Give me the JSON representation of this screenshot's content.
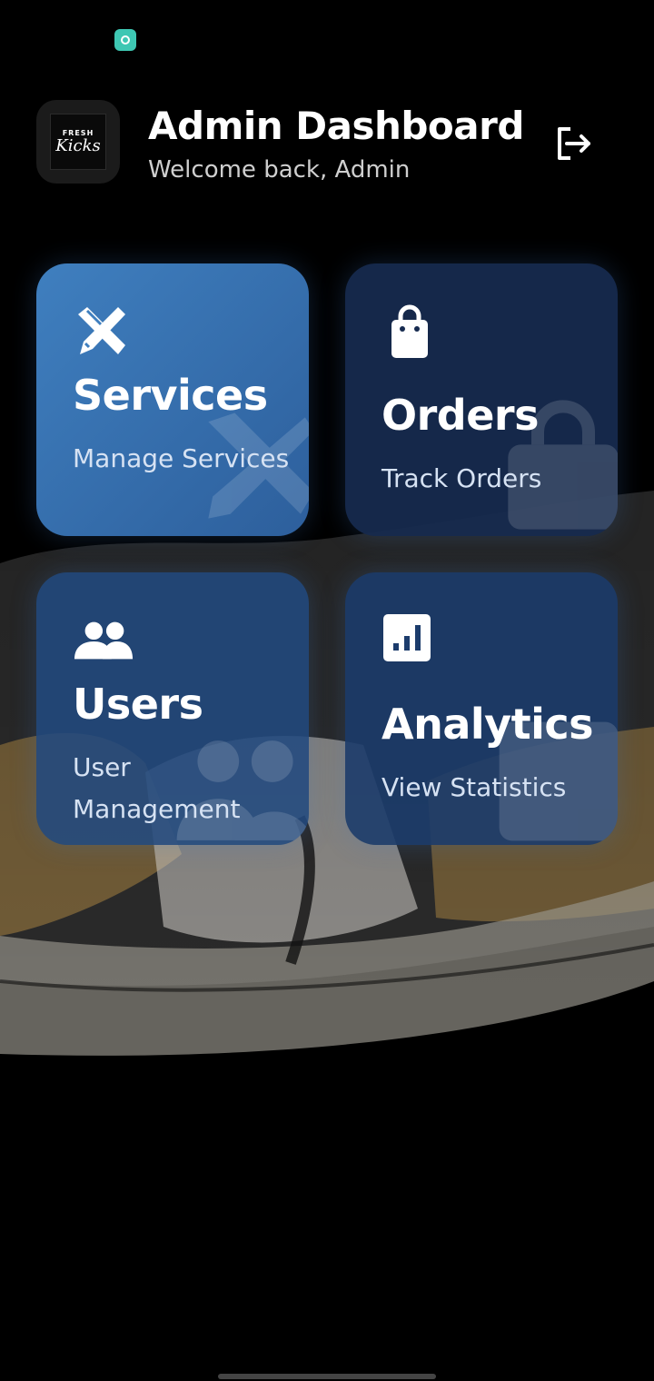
{
  "header": {
    "title": "Admin Dashboard",
    "subtitle": "Welcome back, Admin",
    "logo": {
      "top": "FRESH",
      "main": "Kicks"
    }
  },
  "cards": [
    {
      "title": "Services",
      "subtitle": "Manage Services",
      "icon": "tools-icon",
      "color": "#3f7fbf"
    },
    {
      "title": "Orders",
      "subtitle": "Track Orders",
      "icon": "shopping-bag-icon",
      "color": "#172b50"
    },
    {
      "title": "Users",
      "subtitle": "User Management",
      "icon": "users-icon",
      "color": "#224a80"
    },
    {
      "title": "Analytics",
      "subtitle": "View Statistics",
      "icon": "bar-chart-icon",
      "color": "#1c3c6c"
    }
  ],
  "colors": {
    "background": "#000000",
    "accent": "#3f7fbf",
    "status_icon": "#3ec7b3"
  }
}
